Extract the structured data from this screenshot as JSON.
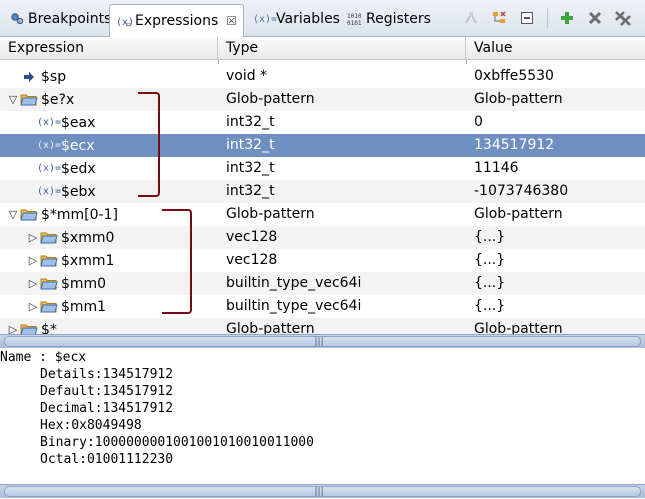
{
  "tabs": [
    {
      "label": "Breakpoints",
      "icon": "breakpoints-icon",
      "active": false
    },
    {
      "label": "Expressions",
      "icon": "expressions-icon",
      "active": true
    },
    {
      "label": "Variables",
      "icon": "variables-icon",
      "active": false
    },
    {
      "label": "Registers",
      "icon": "registers-icon",
      "active": false
    }
  ],
  "tab_close_glyph": "☒",
  "toolbar": [
    "show-logical-structure-icon",
    "collapse-all-icon",
    "minimize-icon",
    "add-expression-icon",
    "remove-icon",
    "remove-all-icon"
  ],
  "columns": {
    "expression": "Expression",
    "type": "Type",
    "value": "Value"
  },
  "rows": [
    {
      "indent": 0,
      "twist": "",
      "icon": "arrow-icon",
      "name": "$sp",
      "type": "void *",
      "value": "0xbffe5530"
    },
    {
      "indent": 0,
      "twist": "expanded",
      "icon": "folder-icon",
      "name": "$e?x",
      "type": "Glob-pattern",
      "value": "Glob-pattern"
    },
    {
      "indent": 1,
      "twist": "",
      "icon": "variable-icon",
      "name": "$eax",
      "type": "int32_t",
      "value": "0"
    },
    {
      "indent": 1,
      "twist": "",
      "icon": "variable-icon",
      "name": "$ecx",
      "type": "int32_t",
      "value": "134517912",
      "selected": true
    },
    {
      "indent": 1,
      "twist": "",
      "icon": "variable-icon",
      "name": "$edx",
      "type": "int32_t",
      "value": "11146"
    },
    {
      "indent": 1,
      "twist": "",
      "icon": "variable-icon",
      "name": "$ebx",
      "type": "int32_t",
      "value": "-1073746380"
    },
    {
      "indent": 0,
      "twist": "expanded",
      "icon": "folder-icon",
      "name": "$*mm[0-1]",
      "type": "Glob-pattern",
      "value": "Glob-pattern"
    },
    {
      "indent": 1,
      "twist": "collapsed",
      "icon": "folder-icon",
      "name": "$xmm0",
      "type": "vec128",
      "value": "{...}"
    },
    {
      "indent": 1,
      "twist": "collapsed",
      "icon": "folder-icon",
      "name": "$xmm1",
      "type": "vec128",
      "value": "{...}"
    },
    {
      "indent": 1,
      "twist": "collapsed",
      "icon": "folder-icon",
      "name": "$mm0",
      "type": "builtin_type_vec64i",
      "value": "{...}"
    },
    {
      "indent": 1,
      "twist": "collapsed",
      "icon": "folder-icon",
      "name": "$mm1",
      "type": "builtin_type_vec64i",
      "value": "{...}"
    },
    {
      "indent": 0,
      "twist": "collapsed",
      "icon": "folder-icon",
      "name": "$*",
      "type": "Glob-pattern",
      "value": "Glob-pattern"
    }
  ],
  "details": {
    "name_line": "Name : $ecx",
    "lines": [
      "Details:134517912",
      "Default:134517912",
      "Decimal:134517912",
      "Hex:0x8049498",
      "Binary:1000000001001001010010011000",
      "Octal:01001112230"
    ]
  },
  "scroll_grip": "|||"
}
